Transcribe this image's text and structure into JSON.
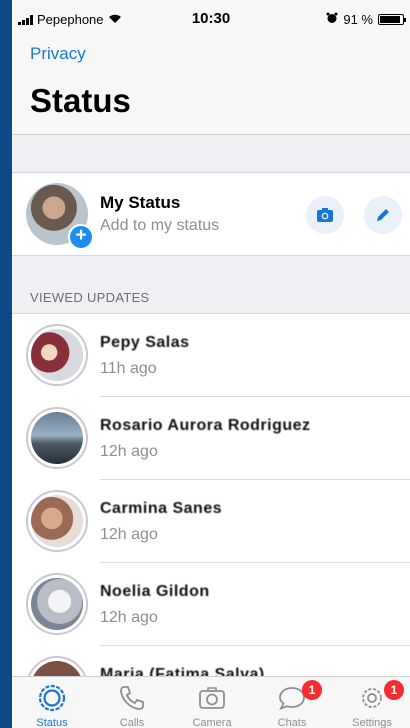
{
  "status_bar": {
    "carrier": "Pepephone",
    "time": "10:30",
    "battery": "91 %",
    "battery_level": 0.91
  },
  "header": {
    "back_label": "Privacy",
    "title": "Status"
  },
  "my_status": {
    "name": "My Status",
    "subtitle": "Add to my status"
  },
  "section_label": "VIEWED UPDATES",
  "updates": [
    {
      "name": "Pepy Salas",
      "time": "11h ago"
    },
    {
      "name": "Rosario Aurora Rodriguez",
      "time": "12h ago"
    },
    {
      "name": "Carmina Sanes",
      "time": "12h ago"
    },
    {
      "name": "Noelia Gildon",
      "time": "12h ago"
    },
    {
      "name": "Maria (Fatima Salva)",
      "time": ""
    }
  ],
  "tabs": [
    {
      "label": "Status",
      "badge": ""
    },
    {
      "label": "Calls",
      "badge": ""
    },
    {
      "label": "Camera",
      "badge": ""
    },
    {
      "label": "Chats",
      "badge": "1"
    },
    {
      "label": "Settings",
      "badge": "1"
    }
  ],
  "colors": {
    "accent": "#1877d2",
    "badge": "#f52d32",
    "frame": "#0d4a87"
  }
}
